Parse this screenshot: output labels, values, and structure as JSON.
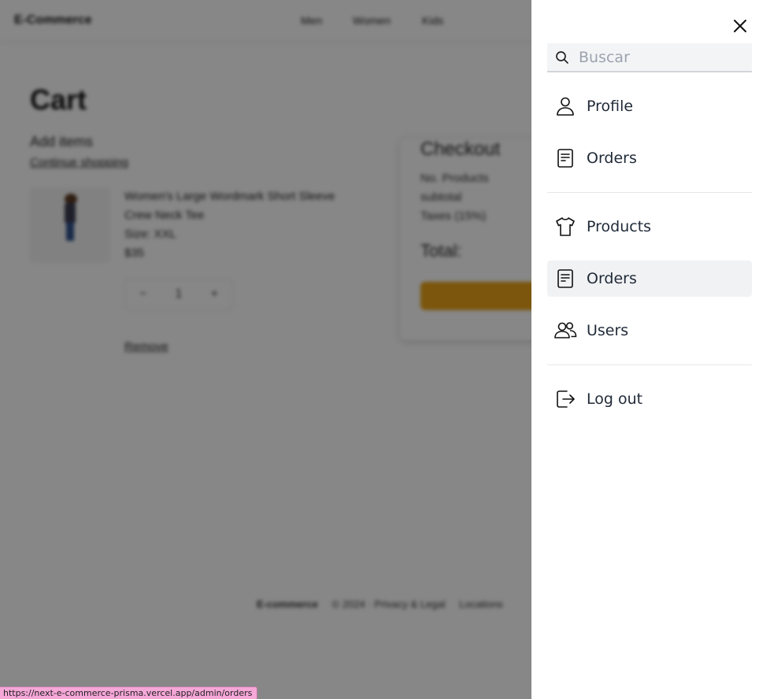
{
  "background": {
    "brand": "E-Commerce",
    "nav_links": [
      "Men",
      "Women",
      "Kids"
    ],
    "cart_title": "Cart",
    "add_items": "Add items",
    "continue_shopping": "Continue shopping",
    "product": {
      "title_line1": "Women's Large Wordmark Short Sleeve",
      "title_line2": "Crew Neck Tee",
      "size": "Size: XXL",
      "price": "$35"
    },
    "quantity": {
      "minus": "−",
      "value": "1",
      "plus": "+"
    },
    "remove": "Remove",
    "checkout": {
      "title": "Checkout",
      "products_label": "No. Products",
      "subtotal_label": "subtotal",
      "taxes_label": "Taxes (15%)",
      "total_label": "Total:"
    },
    "footer": {
      "brand": "E-commerce",
      "copyright": "© 2024 · Privacy & Legal",
      "locations": "Locations"
    }
  },
  "drawer": {
    "search_placeholder": "Buscar",
    "items": [
      {
        "label": "Profile",
        "icon": "user-icon"
      },
      {
        "label": "Orders",
        "icon": "document-icon"
      },
      {
        "label": "Products",
        "icon": "tshirt-icon"
      },
      {
        "label": "Orders",
        "icon": "document-icon",
        "active": true
      },
      {
        "label": "Users",
        "icon": "users-icon"
      },
      {
        "label": "Log out",
        "icon": "logout-icon"
      }
    ]
  },
  "status_bar": {
    "url": "https://next-e-commerce-prisma.vercel.app/admin/orders"
  },
  "colors": {
    "overlay": "#000000",
    "checkout_button": "#e8a317",
    "active_item_bg": "#f1f2f4",
    "status_bar_bg": "#f5a7d8"
  }
}
